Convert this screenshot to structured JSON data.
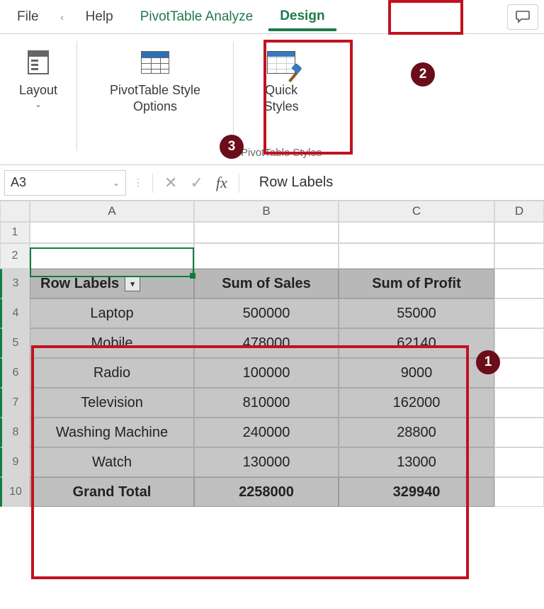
{
  "tabs": {
    "file": "File",
    "help": "Help",
    "analyze": "PivotTable Analyze",
    "design": "Design"
  },
  "ribbon": {
    "layout": "Layout",
    "styleOptions": "PivotTable Style\nOptions",
    "quickStyles": "Quick\nStyles",
    "groupLabel": "PivotTable Styles"
  },
  "badges": {
    "n1": "1",
    "n2": "2",
    "n3": "3"
  },
  "formulaBar": {
    "nameBox": "A3",
    "value": "Row Labels"
  },
  "columns": [
    "A",
    "B",
    "C",
    "D"
  ],
  "rows": [
    "1",
    "2",
    "3",
    "4",
    "5",
    "6",
    "7",
    "8",
    "9",
    "10"
  ],
  "pivot": {
    "headers": {
      "rowLabels": "Row Labels",
      "sales": "Sum of Sales",
      "profit": "Sum of Profit"
    },
    "items": [
      {
        "label": "Laptop",
        "sales": "500000",
        "profit": "55000"
      },
      {
        "label": "Mobile",
        "sales": "478000",
        "profit": "62140"
      },
      {
        "label": "Radio",
        "sales": "100000",
        "profit": "9000"
      },
      {
        "label": "Television",
        "sales": "810000",
        "profit": "162000"
      },
      {
        "label": "Washing Machine",
        "sales": "240000",
        "profit": "28800"
      },
      {
        "label": "Watch",
        "sales": "130000",
        "profit": "13000"
      }
    ],
    "total": {
      "label": "Grand Total",
      "sales": "2258000",
      "profit": "329940"
    }
  },
  "glyphs": {
    "chevLeft": "‹",
    "chevDown": "⌄",
    "cancel": "✕",
    "confirm": "✓",
    "fx": "fx",
    "filterDown": "▾",
    "comment": "💬"
  }
}
